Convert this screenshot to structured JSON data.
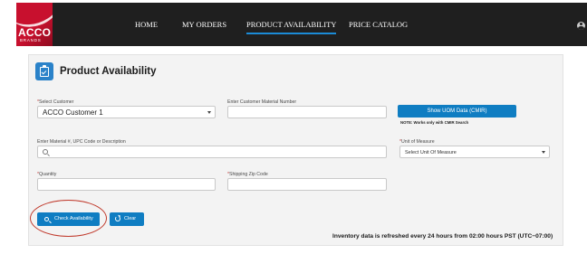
{
  "brand": {
    "name": "ACCO",
    "sub": "BRANDS"
  },
  "nav": {
    "items": [
      {
        "label": "HOME"
      },
      {
        "label": "MY ORDERS"
      },
      {
        "label": "PRODUCT AVAILABILITY",
        "active": true
      },
      {
        "label": "PRICE CATALOG"
      }
    ],
    "user_icon": "user-avatar-icon"
  },
  "page": {
    "title": "Product Availability",
    "icon": "clipboard-check-icon"
  },
  "form": {
    "customer": {
      "label": "Select Customer",
      "required": "*",
      "value": "ACCO Customer 1"
    },
    "customer_material": {
      "label": "Enter Customer Material Number",
      "value": ""
    },
    "uom_button": {
      "label": "Show UOM Data (CMIR)",
      "note": "NOTE: Works only with CMIR Search"
    },
    "material": {
      "label": "Enter Material #, UPC Code or Description",
      "value": ""
    },
    "unit_of_measure": {
      "label": "Unit of Measure",
      "required": "*",
      "value": "Select Unit Of Measure"
    },
    "quantity": {
      "label": "Quantity",
      "required": "*",
      "value": ""
    },
    "zip": {
      "label": "Shipping Zip Code",
      "required": "*",
      "value": ""
    }
  },
  "actions": {
    "check": {
      "label": "Check Availability",
      "icon": "search-icon"
    },
    "clear": {
      "label": "Clear",
      "icon": "refresh-icon"
    }
  },
  "refresh_note": "Inventory data is refreshed every 24 hours from 02:00 hours PST (UTC−07:00)",
  "colors": {
    "nav_bg": "#1f1f1f",
    "brand_red": "#c8102e",
    "button_blue": "#0f7dc2",
    "highlight": "#c0392b",
    "active_underline": "#1b8bd6"
  }
}
